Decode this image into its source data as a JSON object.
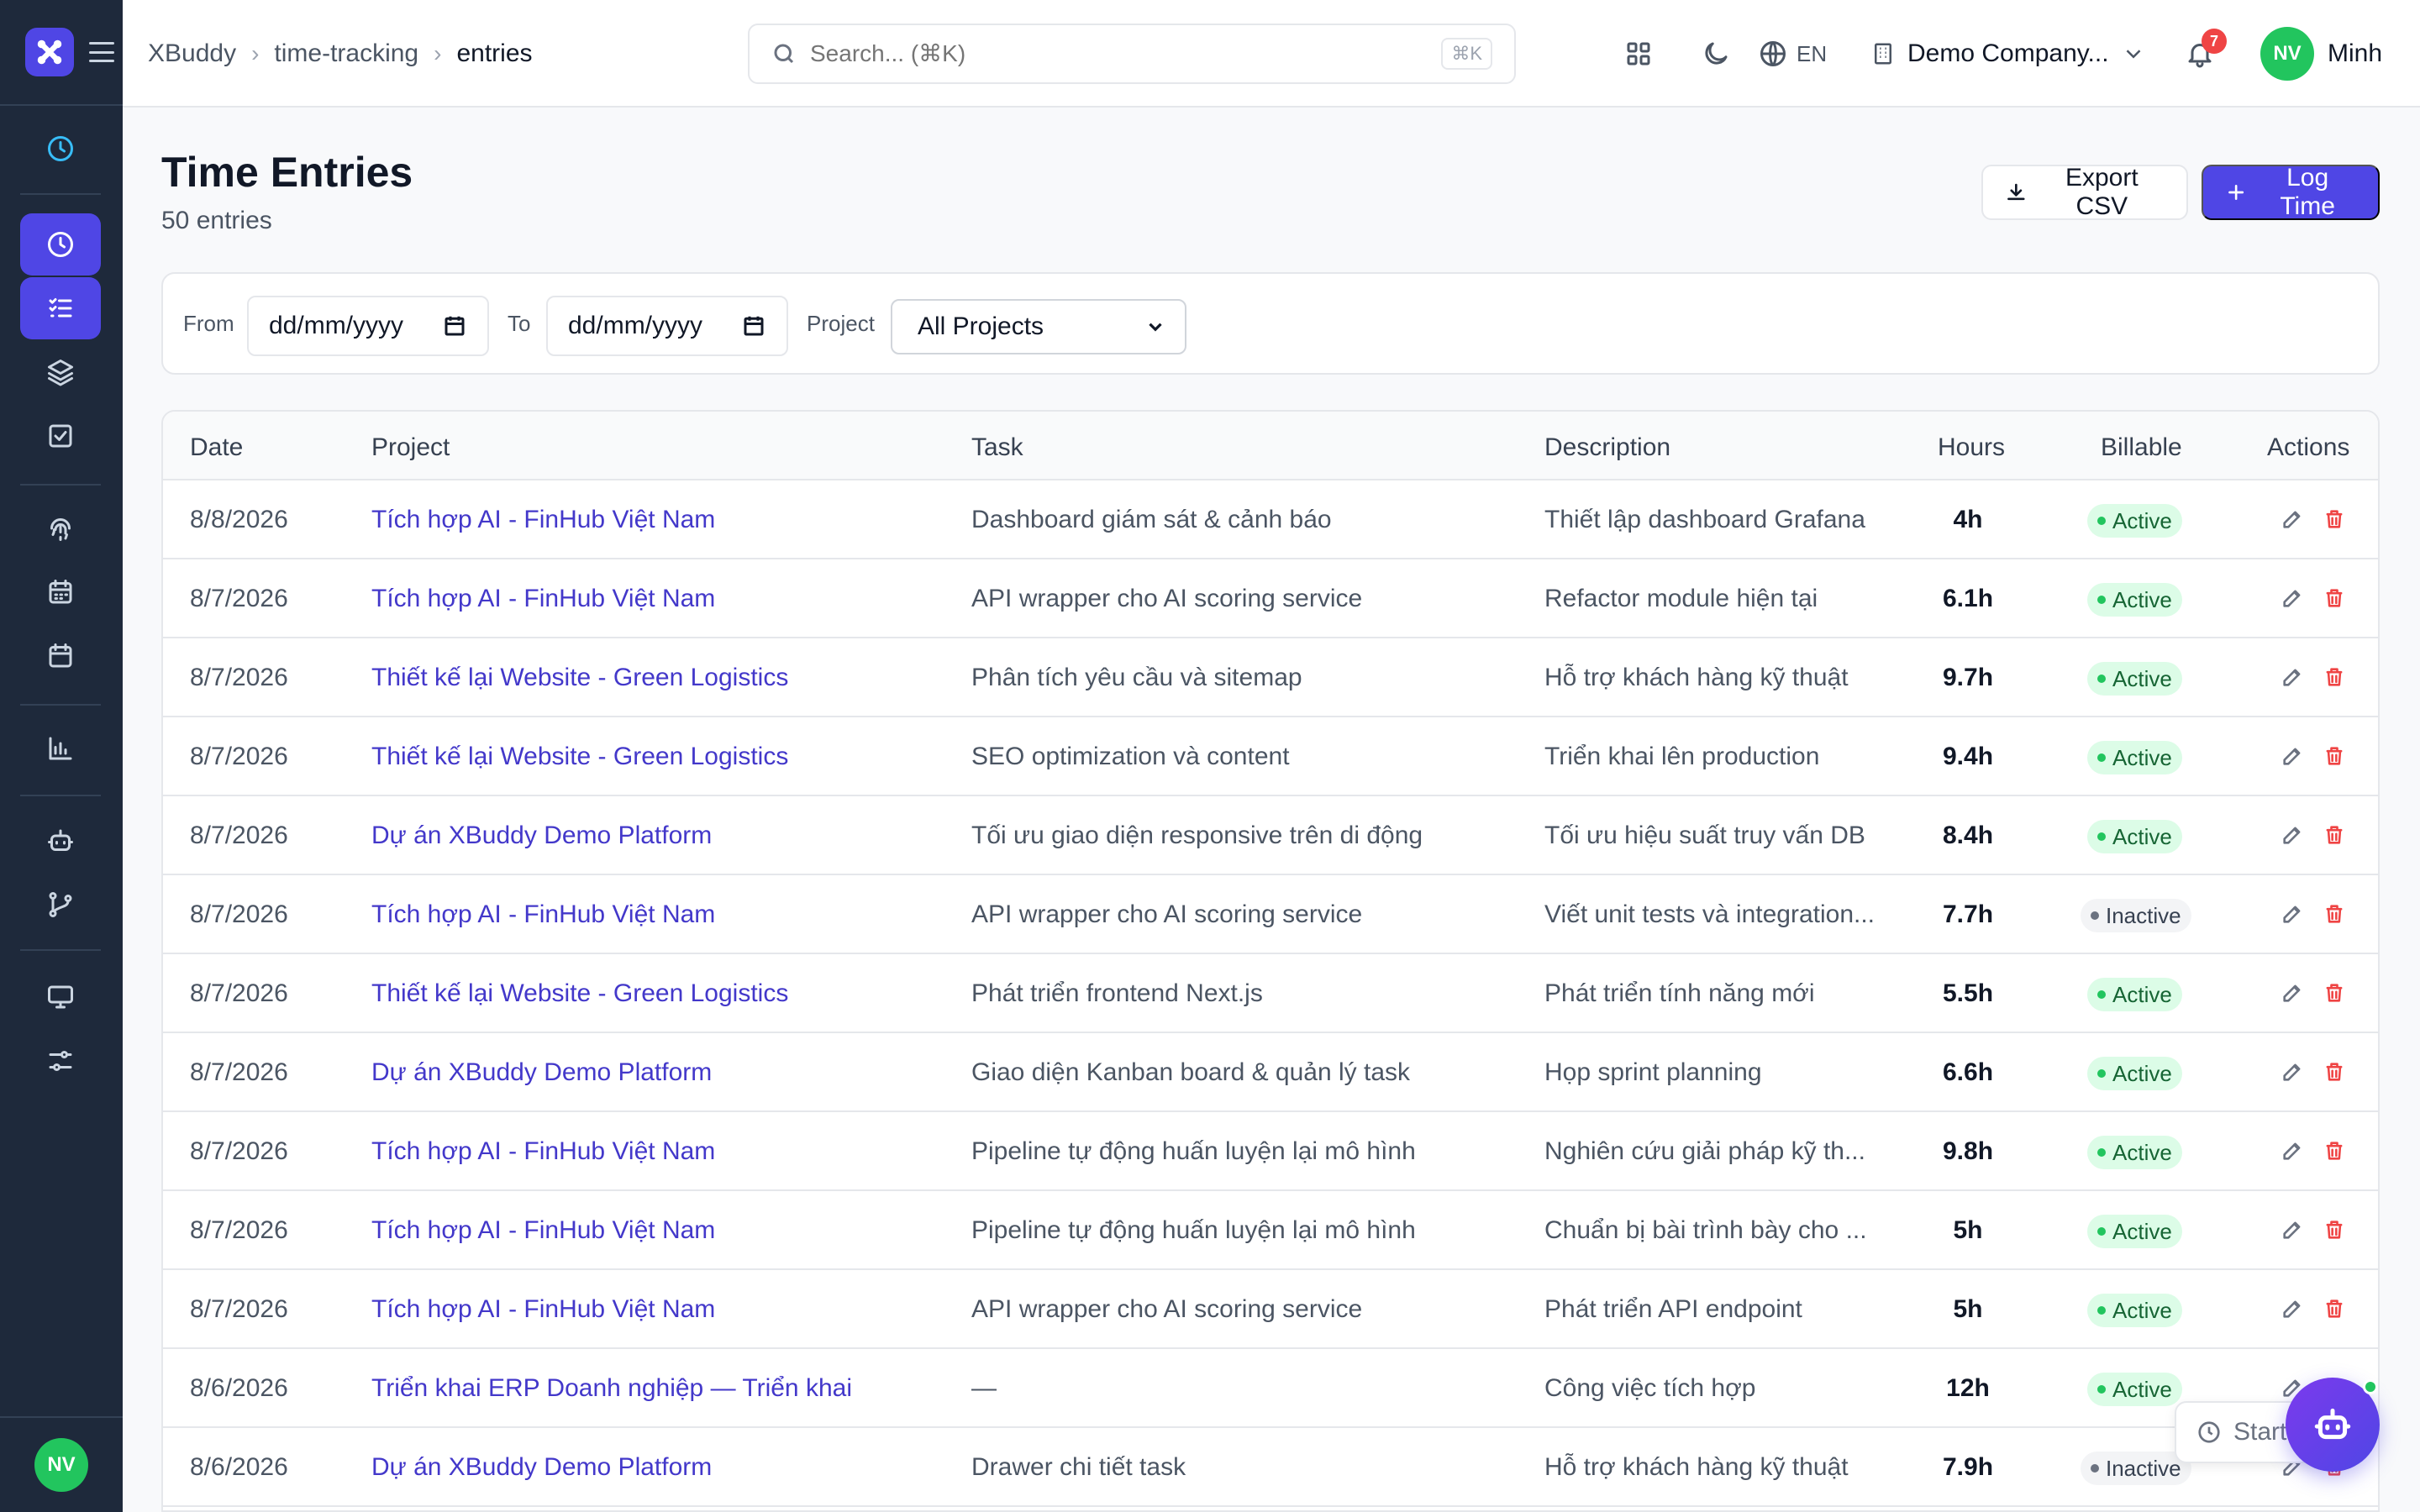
{
  "breadcrumb": [
    "XBuddy",
    "time-tracking",
    "entries"
  ],
  "search": {
    "placeholder": "Search... (⌘K)",
    "shortcut": "⌘K"
  },
  "header": {
    "language": "EN",
    "company": "Demo Company...",
    "notifications": "7",
    "user_initials": "NV",
    "user_name": "Minh"
  },
  "sidebar": {
    "avatar_initials": "NV",
    "icons": [
      "clock-icon",
      "clock-icon",
      "list-check-icon",
      "layers-icon",
      "checkbox-icon",
      "fingerprint-icon",
      "calendar-days-icon",
      "calendar-icon",
      "bar-chart-icon",
      "bot-icon",
      "git-branch-icon",
      "monitor-icon",
      "sliders-icon"
    ]
  },
  "page": {
    "title": "Time Entries",
    "subtitle": "50 entries"
  },
  "actions": {
    "export": "Export CSV",
    "log": "Log Time"
  },
  "filters": {
    "from_label": "From",
    "to_label": "To",
    "project_label": "Project",
    "from_value": "dd/mm/yyyy",
    "to_value": "dd/mm/yyyy",
    "project_value": "All Projects"
  },
  "table": {
    "columns": [
      "Date",
      "Project",
      "Task",
      "Description",
      "Hours",
      "Billable",
      "Actions"
    ],
    "rows": [
      {
        "date": "8/8/2026",
        "project": "Tích hợp AI - FinHub Việt Nam",
        "task": "Dashboard giám sát & cảnh báo",
        "desc": "Thiết lập dashboard Grafana",
        "hours": "4h",
        "billable": "Active"
      },
      {
        "date": "8/7/2026",
        "project": "Tích hợp AI - FinHub Việt Nam",
        "task": "API wrapper cho AI scoring service",
        "desc": "Refactor module hiện tại",
        "hours": "6.1h",
        "billable": "Active"
      },
      {
        "date": "8/7/2026",
        "project": "Thiết kế lại Website - Green Logistics",
        "task": "Phân tích yêu cầu và sitemap",
        "desc": "Hỗ trợ khách hàng kỹ thuật",
        "hours": "9.7h",
        "billable": "Active"
      },
      {
        "date": "8/7/2026",
        "project": "Thiết kế lại Website - Green Logistics",
        "task": "SEO optimization và content",
        "desc": "Triển khai lên production",
        "hours": "9.4h",
        "billable": "Active"
      },
      {
        "date": "8/7/2026",
        "project": "Dự án XBuddy Demo Platform",
        "task": "Tối ưu giao diện responsive trên di động",
        "desc": "Tối ưu hiệu suất truy vấn DB",
        "hours": "8.4h",
        "billable": "Active"
      },
      {
        "date": "8/7/2026",
        "project": "Tích hợp AI - FinHub Việt Nam",
        "task": "API wrapper cho AI scoring service",
        "desc": "Viết unit tests và integration...",
        "hours": "7.7h",
        "billable": "Inactive"
      },
      {
        "date": "8/7/2026",
        "project": "Thiết kế lại Website - Green Logistics",
        "task": "Phát triển frontend Next.js",
        "desc": "Phát triển tính năng mới",
        "hours": "5.5h",
        "billable": "Active"
      },
      {
        "date": "8/7/2026",
        "project": "Dự án XBuddy Demo Platform",
        "task": "Giao diện Kanban board & quản lý task",
        "desc": "Họp sprint planning",
        "hours": "6.6h",
        "billable": "Active"
      },
      {
        "date": "8/7/2026",
        "project": "Tích hợp AI - FinHub Việt Nam",
        "task": "Pipeline tự động huấn luyện lại mô hình",
        "desc": "Nghiên cứu giải pháp kỹ th...",
        "hours": "9.8h",
        "billable": "Active"
      },
      {
        "date": "8/7/2026",
        "project": "Tích hợp AI - FinHub Việt Nam",
        "task": "Pipeline tự động huấn luyện lại mô hình",
        "desc": "Chuẩn bị bài trình bày cho ...",
        "hours": "5h",
        "billable": "Active"
      },
      {
        "date": "8/7/2026",
        "project": "Tích hợp AI - FinHub Việt Nam",
        "task": "API wrapper cho AI scoring service",
        "desc": "Phát triển API endpoint",
        "hours": "5h",
        "billable": "Active"
      },
      {
        "date": "8/6/2026",
        "project": "Triển khai ERP Doanh nghiệp — Triển khai",
        "task": "—",
        "desc": "Công việc tích hợp",
        "hours": "12h",
        "billable": "Active"
      },
      {
        "date": "8/6/2026",
        "project": "Dự án XBuddy Demo Platform",
        "task": "Drawer chi tiết task",
        "desc": "Hỗ trợ khách hàng kỹ thuật",
        "hours": "7.9h",
        "billable": "Inactive"
      }
    ]
  },
  "floating": {
    "timer_label": "Start"
  },
  "colors": {
    "accent": "#4f46e5",
    "sidebar": "#1e293b",
    "active_badge": "#dcfce7",
    "danger": "#ef4444"
  }
}
